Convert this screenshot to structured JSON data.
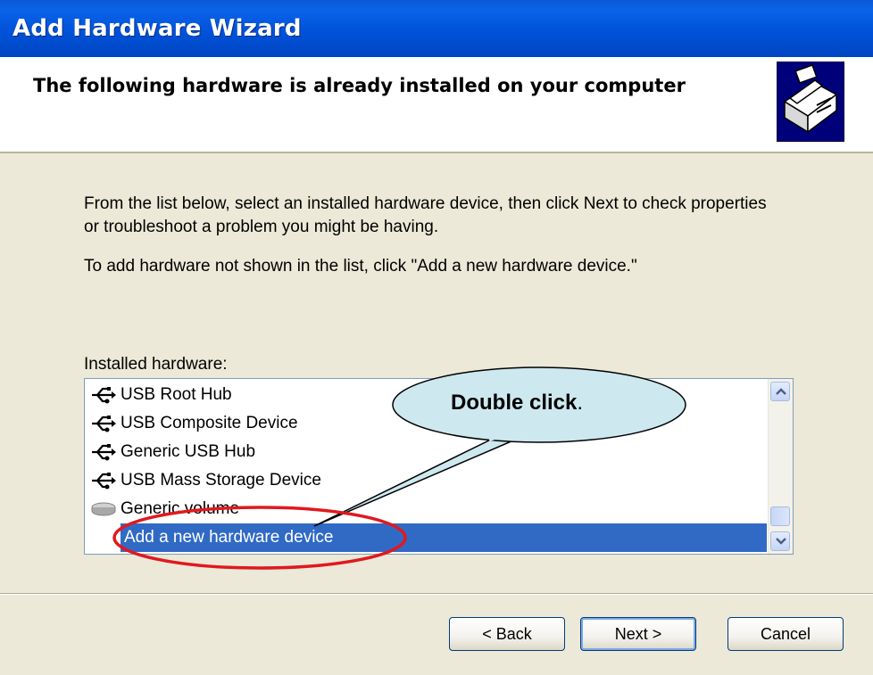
{
  "window": {
    "title": "Add Hardware Wizard"
  },
  "header": {
    "heading": "The following hardware is already installed on your computer",
    "icon": "hardware-wizard-icon"
  },
  "content": {
    "paragraph1": "From the list below, select an installed hardware device, then click Next to check properties or troubleshoot a problem you might be having.",
    "paragraph2": "To add hardware not shown in the list, click \"Add a new hardware device.\"",
    "installed_label": "Installed hardware:"
  },
  "list": {
    "items": [
      {
        "label": "USB Root Hub",
        "icon": "usb-icon"
      },
      {
        "label": "USB Composite Device",
        "icon": "usb-icon"
      },
      {
        "label": "Generic USB Hub",
        "icon": "usb-icon"
      },
      {
        "label": "USB Mass Storage Device",
        "icon": "usb-icon"
      },
      {
        "label": "Generic volume",
        "icon": "drive-icon"
      },
      {
        "label": "Add a new hardware device",
        "icon": "",
        "selected": true
      }
    ]
  },
  "buttons": {
    "back": "< Back",
    "next": "Next >",
    "cancel": "Cancel"
  },
  "annotation": {
    "callout_bold": "Double click",
    "callout_tail": "."
  },
  "colors": {
    "titlebar": "#0052d9",
    "selection": "#316ac5",
    "callout_fill": "#cde8ef",
    "highlight_ellipse": "#e0191e"
  }
}
